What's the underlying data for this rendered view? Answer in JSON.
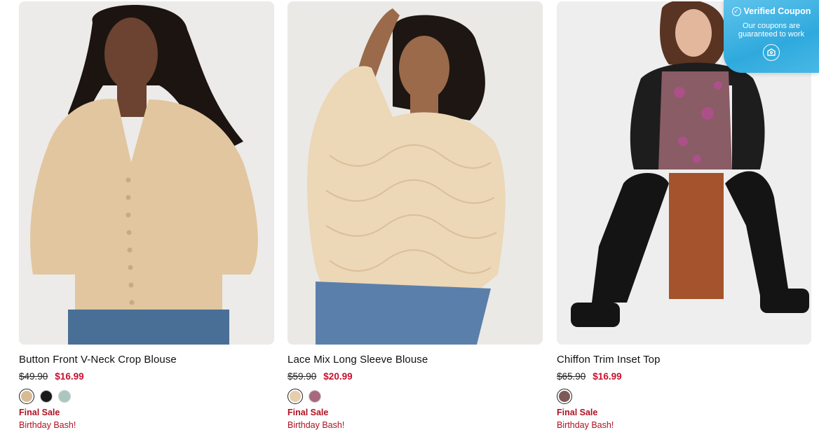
{
  "products": [
    {
      "title": "Button Front V-Neck Crop Blouse",
      "old_price": "$49.90",
      "sale_price": "$16.99",
      "swatches": [
        {
          "color": "#d8bb95",
          "selected": true
        },
        {
          "color": "#1a1a1a",
          "selected": false
        },
        {
          "color": "#a9c7c0",
          "selected": false
        }
      ],
      "badge": "Final Sale",
      "promo": "Birthday Bash!",
      "colors": {
        "bg": "#ecebe9",
        "skin": "#6b4330",
        "hair": "#1c1411",
        "top": "#e2c69f",
        "bottom": "#4a6f96"
      }
    },
    {
      "title": "Lace Mix Long Sleeve Blouse",
      "old_price": "$59.90",
      "sale_price": "$20.99",
      "swatches": [
        {
          "color": "#e7cdaa",
          "selected": true
        },
        {
          "color": "#a8687f",
          "selected": false
        }
      ],
      "badge": "Final Sale",
      "promo": "Birthday Bash!",
      "colors": {
        "bg": "#eae9e6",
        "skin": "#9a6a4b",
        "hair": "#1e1612",
        "top": "#ecd7b6",
        "bottom": "#5b7fab"
      }
    },
    {
      "title": "Chiffon Trim Inset Top",
      "old_price": "$65.90",
      "sale_price": "$16.99",
      "swatches": [
        {
          "color": "#7d5a58",
          "selected": true
        }
      ],
      "badge": "Final Sale",
      "promo": "Birthday Bash!",
      "colors": {
        "bg": "#eeeeee",
        "skin": "#e3b79c",
        "hair": "#5a3422",
        "top": "#8a5c66",
        "bottom": "#141414"
      }
    }
  ],
  "coupon": {
    "title": "Verified Coupon",
    "subtitle": "Our coupons are guaranteed to work",
    "icons": [
      "check-circle-icon",
      "ticket-icon"
    ]
  }
}
